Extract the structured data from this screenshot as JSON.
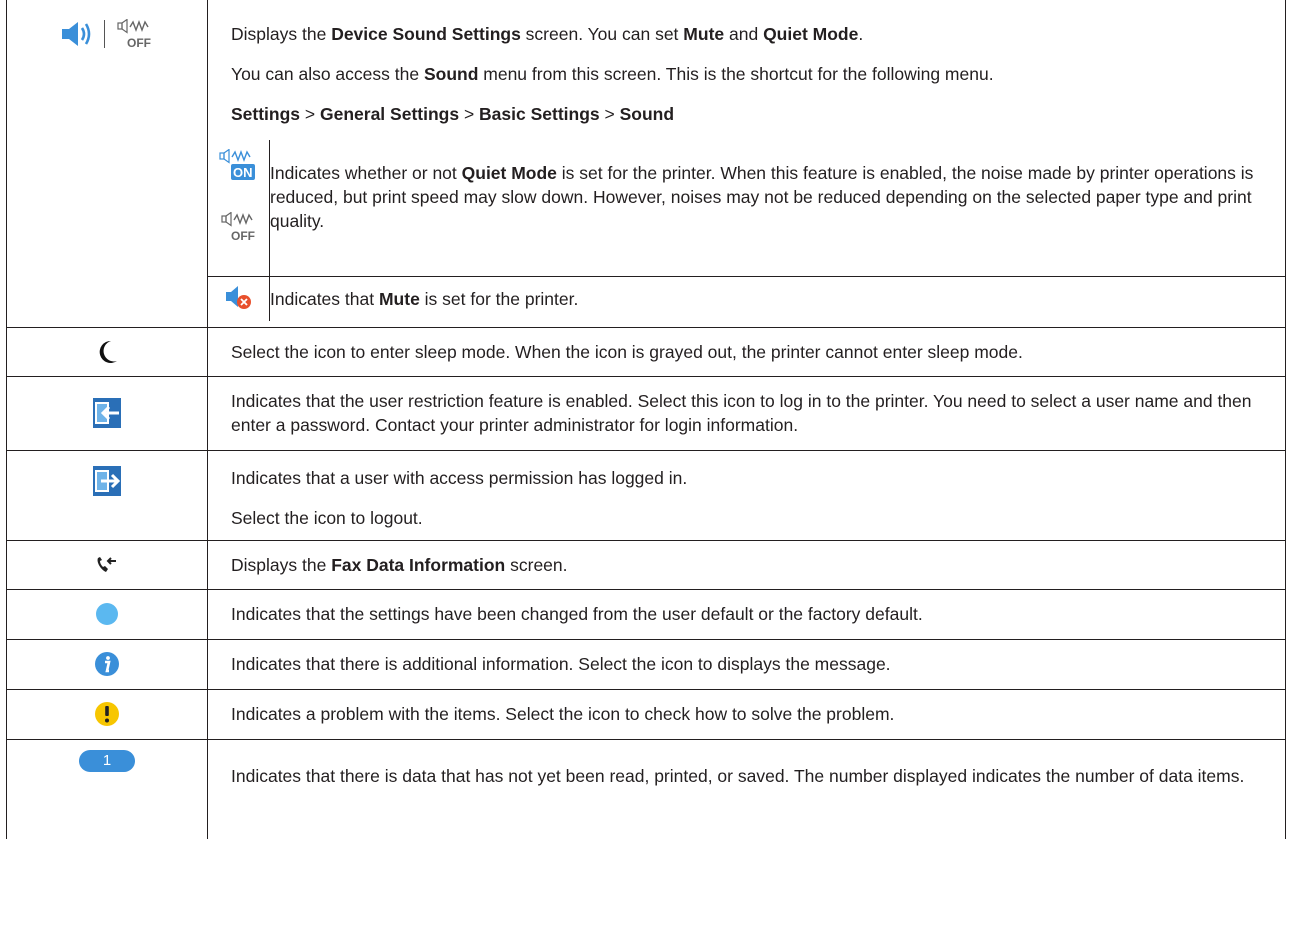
{
  "rows": {
    "sound": {
      "icons": [
        "speaker-icon",
        "quiet-mode-off-icon"
      ],
      "line1": [
        "Displays the ",
        "Device Sound Settings",
        " screen. You can set ",
        "Mute",
        " and ",
        "Quiet Mode",
        "."
      ],
      "line2": [
        "You can also access the ",
        "Sound",
        " menu from this screen. This is the shortcut for the following menu."
      ],
      "path": [
        "Settings",
        " > ",
        "General Settings",
        " > ",
        "Basic Settings",
        " > ",
        "Sound"
      ],
      "sub_quiet": {
        "icons": [
          "quiet-mode-on-icon",
          "quiet-mode-off-icon"
        ],
        "on_label": "ON",
        "off_label": "OFF",
        "text": [
          "Indicates whether or not ",
          "Quiet Mode",
          " is set for the printer. When this feature is enabled, the noise made by printer operations is reduced, but print speed may slow down. However, noises may not be reduced depending on the selected paper type and print quality."
        ]
      },
      "sub_mute": {
        "icon": "mute-icon",
        "text": [
          "Indicates that ",
          "Mute",
          " is set for the printer."
        ]
      }
    },
    "sleep": {
      "icon": "moon-icon",
      "text": "Select the icon to enter sleep mode. When the icon is grayed out, the printer cannot enter sleep mode."
    },
    "login": {
      "icon": "login-icon",
      "text": "Indicates that the user restriction feature is enabled. Select this icon to log in to the printer. You need to select a user name and then enter a password. Contact your printer administrator for login information."
    },
    "logout": {
      "icon": "logout-icon",
      "text1": "Indicates that a user with access permission has logged in.",
      "text2": "Select the icon to logout."
    },
    "fax": {
      "icon": "fax-data-icon",
      "text": [
        "Displays the ",
        "Fax Data Information",
        " screen."
      ]
    },
    "changed": {
      "icon": "blue-dot-icon",
      "text": "Indicates that the settings have been changed from the user default or the factory default."
    },
    "info": {
      "icon": "info-icon",
      "text": "Indicates that there is additional information. Select the icon to displays the message."
    },
    "problem": {
      "icon": "warning-icon",
      "text": "Indicates a problem with the items. Select the icon to check how to solve the problem."
    },
    "unread": {
      "icon": "count-badge-icon",
      "badge": "1",
      "text": "Indicates that there is data that has not yet been read, printed, or saved. The number displayed indicates the number of data items."
    }
  },
  "colors": {
    "accent_blue": "#3a8fd9",
    "dot_blue": "#5bb8f0",
    "warning_yellow": "#f7c600",
    "error_orange": "#e8502c",
    "text": "#231f20"
  }
}
